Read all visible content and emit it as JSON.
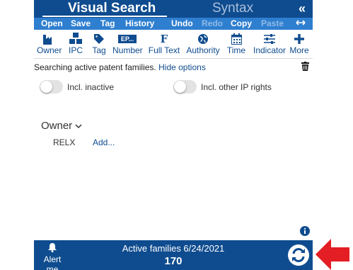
{
  "header": {
    "tab_visual": "Visual Search",
    "tab_syntax": "Syntax",
    "collapse": "«"
  },
  "actions": {
    "open": "Open",
    "save": "Save",
    "tag": "Tag",
    "history": "History",
    "undo": "Undo",
    "redo": "Redo",
    "copy": "Copy",
    "paste": "Paste"
  },
  "toolbar": {
    "owner": "Owner",
    "ipc": "IPC",
    "tag": "Tag",
    "number": "Number",
    "number_badge": "EP...",
    "fulltext": "Full Text",
    "fulltext_glyph": "F",
    "authority": "Authority",
    "time": "Time",
    "indicator": "Indicator",
    "more": "More"
  },
  "status": {
    "text": "Searching active patent families.",
    "hide_options": "Hide options"
  },
  "toggles": {
    "inactive": "Incl. inactive",
    "other_ip": "Incl. other IP rights"
  },
  "owner_group": {
    "title": "Owner",
    "value": "RELX",
    "add": "Add..."
  },
  "footer": {
    "alert": "Alert me",
    "families_label": "Active families 6/24/2021",
    "count": "170"
  },
  "colors": {
    "primary": "#0f4c8f",
    "action_bar": "#2f7fd0",
    "arrow": "#e31e24"
  }
}
